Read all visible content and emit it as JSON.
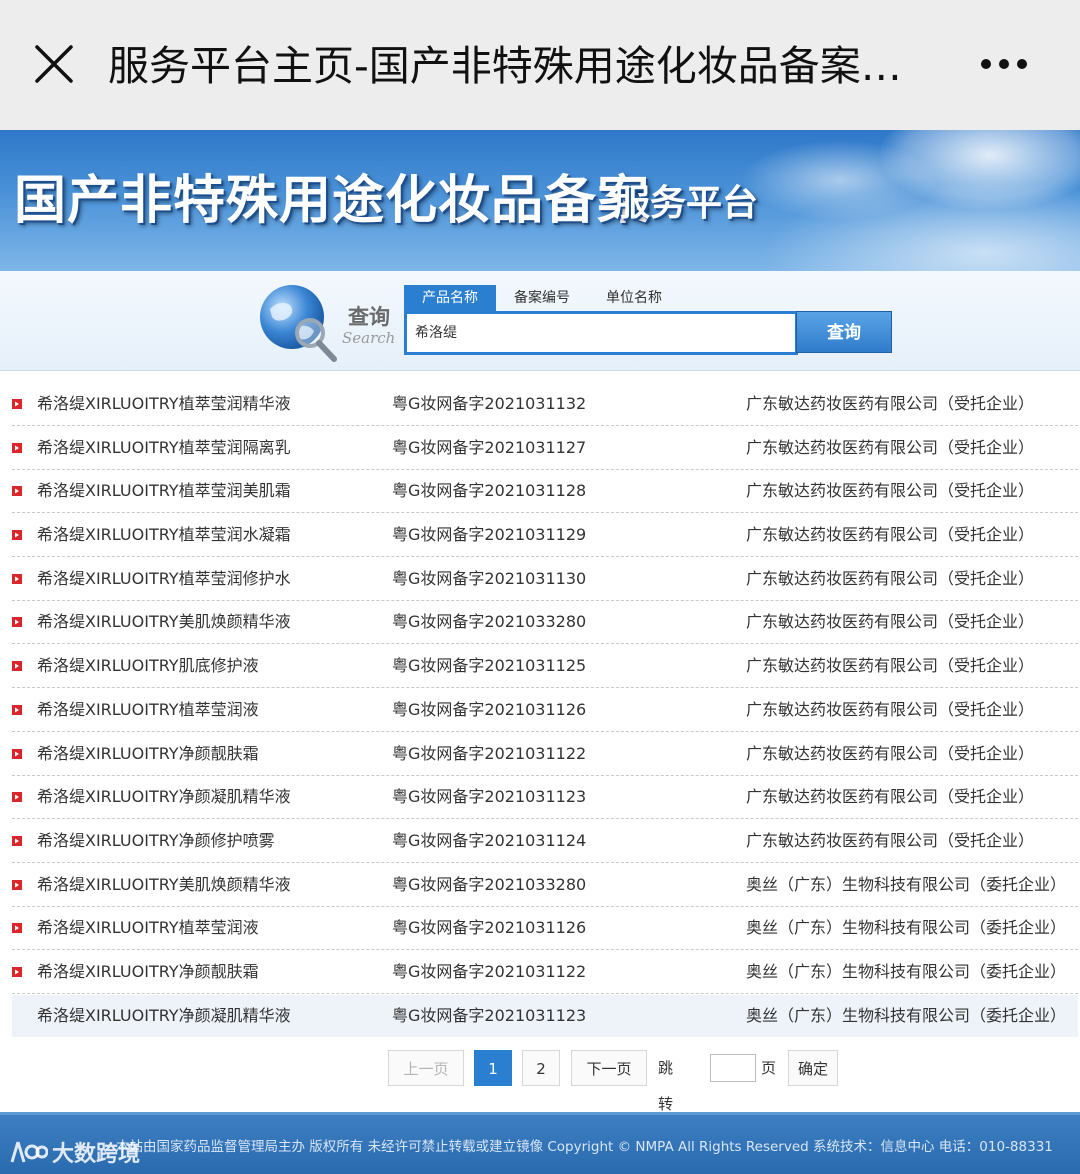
{
  "window": {
    "title": "服务平台主页-国产非特殊用途化妆品备案服务平台"
  },
  "banner": {
    "title": "国产非特殊用途化妆品备案",
    "subtitle": "服务平台"
  },
  "search": {
    "label_cn": "查询",
    "label_en": "Search",
    "tabs": [
      {
        "label": "产品名称",
        "active": true
      },
      {
        "label": "备案编号",
        "active": false
      },
      {
        "label": "单位名称",
        "active": false
      }
    ],
    "query_value": "希洛缇",
    "button_label": "查询"
  },
  "results": [
    {
      "name": "希洛缇XIRLUOITRY植萃莹润精华液",
      "code": "粤G妆网备字2021031132",
      "company": "广东敏达药妆医药有限公司（受托企业）"
    },
    {
      "name": "希洛缇XIRLUOITRY植萃莹润隔离乳",
      "code": "粤G妆网备字2021031127",
      "company": "广东敏达药妆医药有限公司（受托企业）"
    },
    {
      "name": "希洛缇XIRLUOITRY植萃莹润美肌霜",
      "code": "粤G妆网备字2021031128",
      "company": "广东敏达药妆医药有限公司（受托企业）"
    },
    {
      "name": "希洛缇XIRLUOITRY植萃莹润水凝霜",
      "code": "粤G妆网备字2021031129",
      "company": "广东敏达药妆医药有限公司（受托企业）"
    },
    {
      "name": "希洛缇XIRLUOITRY植萃莹润修护水",
      "code": "粤G妆网备字2021031130",
      "company": "广东敏达药妆医药有限公司（受托企业）"
    },
    {
      "name": "希洛缇XIRLUOITRY美肌焕颜精华液",
      "code": "粤G妆网备字2021033280",
      "company": "广东敏达药妆医药有限公司（受托企业）"
    },
    {
      "name": "希洛缇XIRLUOITRY肌底修护液",
      "code": "粤G妆网备字2021031125",
      "company": "广东敏达药妆医药有限公司（受托企业）"
    },
    {
      "name": "希洛缇XIRLUOITRY植萃莹润液",
      "code": "粤G妆网备字2021031126",
      "company": "广东敏达药妆医药有限公司（受托企业）"
    },
    {
      "name": "希洛缇XIRLUOITRY净颜靓肤霜",
      "code": "粤G妆网备字2021031122",
      "company": "广东敏达药妆医药有限公司（受托企业）"
    },
    {
      "name": "希洛缇XIRLUOITRY净颜凝肌精华液",
      "code": "粤G妆网备字2021031123",
      "company": "广东敏达药妆医药有限公司（受托企业）"
    },
    {
      "name": "希洛缇XIRLUOITRY净颜修护喷雾",
      "code": "粤G妆网备字2021031124",
      "company": "广东敏达药妆医药有限公司（受托企业）"
    },
    {
      "name": "希洛缇XIRLUOITRY美肌焕颜精华液",
      "code": "粤G妆网备字2021033280",
      "company": "奥丝（广东）生物科技有限公司（委托企业）"
    },
    {
      "name": "希洛缇XIRLUOITRY植萃莹润液",
      "code": "粤G妆网备字2021031126",
      "company": "奥丝（广东）生物科技有限公司（委托企业）"
    },
    {
      "name": "希洛缇XIRLUOITRY净颜靓肤霜",
      "code": "粤G妆网备字2021031122",
      "company": "奥丝（广东）生物科技有限公司（委托企业）"
    },
    {
      "name": "希洛缇XIRLUOITRY净颜凝肌精华液",
      "code": "粤G妆网备字2021031123",
      "company": "奥丝（广东）生物科技有限公司（委托企业）"
    }
  ],
  "pagination": {
    "prev_label": "上一页",
    "pages": [
      "1",
      "2"
    ],
    "current_page": "1",
    "next_label": "下一页",
    "jump_label": "跳转到",
    "page_unit": "页",
    "confirm_label": "确定"
  },
  "footer": {
    "text": "本站由国家药品监督管理局主办 版权所有 未经许可禁止转载或建立镜像 Copyright © NMPA All Rights Reserved 系统技术：信息中心 电话：010-88331"
  },
  "watermark": {
    "text": "大数跨境"
  },
  "colors": {
    "accent": "#2a7fd0",
    "bullet": "#d9262b",
    "footer_bg": "#2a6aae"
  }
}
